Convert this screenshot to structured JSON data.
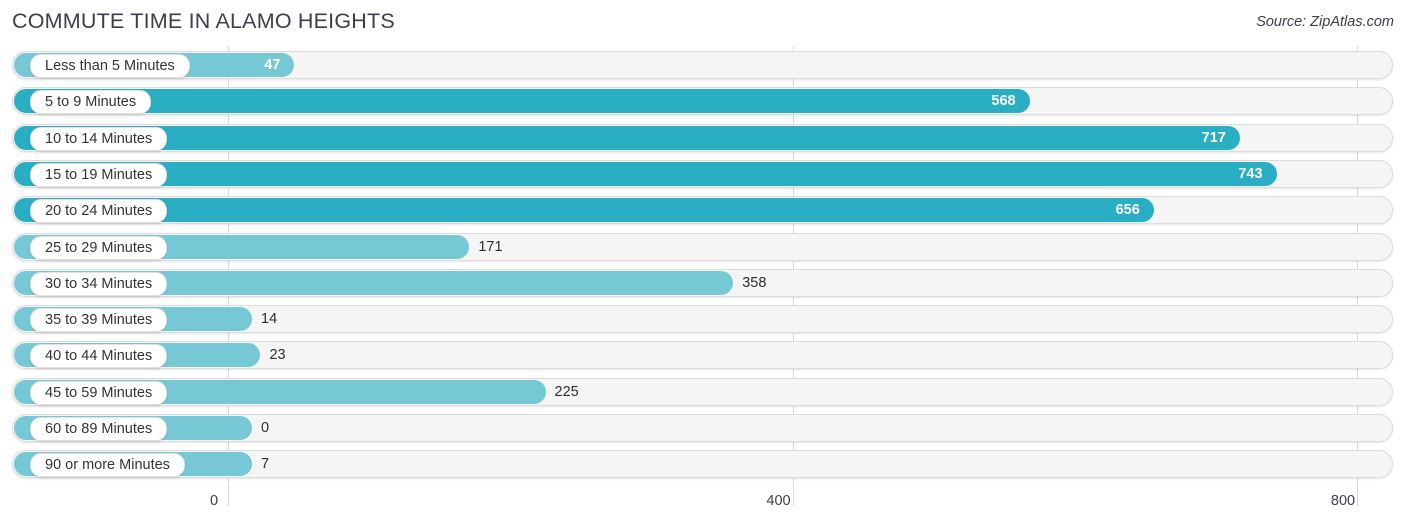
{
  "header": {
    "title": "COMMUTE TIME IN ALAMO HEIGHTS",
    "source": "Source: ZipAtlas.com"
  },
  "colors": {
    "bar_dark": "#29aec3",
    "bar_light": "#77c8d5",
    "track_bg": "#f5f5f5",
    "track_border": "#dcdcdc",
    "gridline": "#d8d8d8",
    "title_text": "#3a3f4b",
    "label_text": "#333333",
    "value_text_inside": "#ffffff",
    "value_text_outside": "#2e2e2e"
  },
  "chart_data": {
    "type": "bar",
    "orientation": "horizontal",
    "title": "COMMUTE TIME IN ALAMO HEIGHTS",
    "subtitle": "",
    "xlabel": "",
    "ylabel": "",
    "xlim": [
      0,
      800
    ],
    "xticks": [
      0,
      400,
      800
    ],
    "xtick_labels": [
      "0",
      "400",
      "800"
    ],
    "grid": true,
    "legend": false,
    "categories": [
      "Less than 5 Minutes",
      "5 to 9 Minutes",
      "10 to 14 Minutes",
      "15 to 19 Minutes",
      "20 to 24 Minutes",
      "25 to 29 Minutes",
      "30 to 34 Minutes",
      "35 to 39 Minutes",
      "40 to 44 Minutes",
      "45 to 59 Minutes",
      "60 to 89 Minutes",
      "90 or more Minutes"
    ],
    "values": [
      47,
      568,
      717,
      743,
      656,
      171,
      358,
      14,
      23,
      225,
      0,
      7
    ],
    "value_labels": [
      "47",
      "568",
      "717",
      "743",
      "656",
      "171",
      "358",
      "14",
      "23",
      "225",
      "0",
      "7"
    ]
  },
  "rows": [
    {
      "label": "Less than 5 Minutes",
      "value": 47,
      "value_label": "47",
      "shade": "light",
      "label_inside": true
    },
    {
      "label": "5 to 9 Minutes",
      "value": 568,
      "value_label": "568",
      "shade": "dark",
      "label_inside": true
    },
    {
      "label": "10 to 14 Minutes",
      "value": 717,
      "value_label": "717",
      "shade": "dark",
      "label_inside": true
    },
    {
      "label": "15 to 19 Minutes",
      "value": 743,
      "value_label": "743",
      "shade": "dark",
      "label_inside": true
    },
    {
      "label": "20 to 24 Minutes",
      "value": 656,
      "value_label": "656",
      "shade": "dark",
      "label_inside": true
    },
    {
      "label": "25 to 29 Minutes",
      "value": 171,
      "value_label": "171",
      "shade": "light",
      "label_inside": false
    },
    {
      "label": "30 to 34 Minutes",
      "value": 358,
      "value_label": "358",
      "shade": "light",
      "label_inside": false
    },
    {
      "label": "35 to 39 Minutes",
      "value": 14,
      "value_label": "14",
      "shade": "light",
      "label_inside": false
    },
    {
      "label": "40 to 44 Minutes",
      "value": 23,
      "value_label": "23",
      "shade": "light",
      "label_inside": false
    },
    {
      "label": "45 to 59 Minutes",
      "value": 225,
      "value_label": "225",
      "shade": "light",
      "label_inside": false
    },
    {
      "label": "60 to 89 Minutes",
      "value": 0,
      "value_label": "0",
      "shade": "light",
      "label_inside": false
    },
    {
      "label": "90 or more Minutes",
      "value": 7,
      "value_label": "7",
      "shade": "light",
      "label_inside": false
    }
  ],
  "axis": {
    "ticks": [
      {
        "label": "0",
        "value": 0
      },
      {
        "label": "400",
        "value": 400
      },
      {
        "label": "800",
        "value": 800
      }
    ]
  }
}
